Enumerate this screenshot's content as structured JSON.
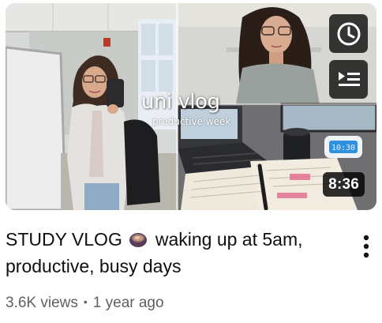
{
  "thumbnail": {
    "overlay_title": "uni vlog",
    "overlay_subtitle": "productive week",
    "duration": "8:36",
    "clock_readout": "10:30"
  },
  "hover_actions": [
    {
      "name": "watch-later",
      "icon": "clock-icon"
    },
    {
      "name": "add-to-queue",
      "icon": "queue-icon"
    }
  ],
  "video": {
    "title_part1": "STUDY VLOG",
    "title_emoji": "coffee-icon",
    "title_part2": "waking up at 5am, productive, busy days",
    "views": "3.6K views",
    "separator": "•",
    "age": "1 year ago"
  },
  "colors": {
    "title": "#0f0f0f",
    "secondary_text": "#606060",
    "overlay_button_bg": "#0f0f0f"
  }
}
